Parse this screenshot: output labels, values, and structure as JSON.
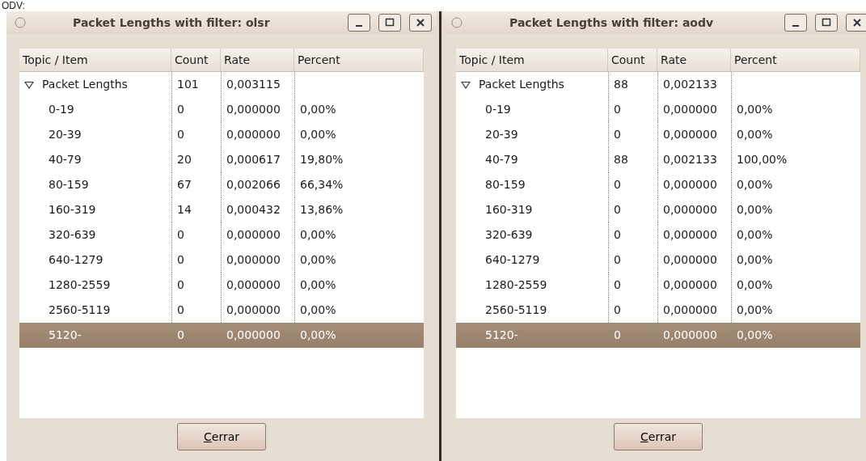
{
  "caption": "ODV:",
  "windows": [
    {
      "title": "Packet Lengths with filter: olsr",
      "columns": [
        "Topic / Item",
        "Count",
        "Rate",
        "Percent"
      ],
      "tree": {
        "label": "Packet Lengths",
        "count": "101",
        "rate": "0,003115",
        "expanded": true,
        "selected": false,
        "children": [
          {
            "label": "0-19",
            "count": "0",
            "rate": "0,000000",
            "percent": "0,00%",
            "selected": false
          },
          {
            "label": "20-39",
            "count": "0",
            "rate": "0,000000",
            "percent": "0,00%",
            "selected": false
          },
          {
            "label": "40-79",
            "count": "20",
            "rate": "0,000617",
            "percent": "19,80%",
            "selected": false
          },
          {
            "label": "80-159",
            "count": "67",
            "rate": "0,002066",
            "percent": "66,34%",
            "selected": false
          },
          {
            "label": "160-319",
            "count": "14",
            "rate": "0,000432",
            "percent": "13,86%",
            "selected": false
          },
          {
            "label": "320-639",
            "count": "0",
            "rate": "0,000000",
            "percent": "0,00%",
            "selected": false
          },
          {
            "label": "640-1279",
            "count": "0",
            "rate": "0,000000",
            "percent": "0,00%",
            "selected": false
          },
          {
            "label": "1280-2559",
            "count": "0",
            "rate": "0,000000",
            "percent": "0,00%",
            "selected": false
          },
          {
            "label": "2560-5119",
            "count": "0",
            "rate": "0,000000",
            "percent": "0,00%",
            "selected": false
          },
          {
            "label": "5120-",
            "count": "0",
            "rate": "0,000000",
            "percent": "0,00%",
            "selected": true
          }
        ]
      },
      "button": {
        "label": "Cerrar",
        "mnemonic": true
      }
    },
    {
      "title": "Packet Lengths with filter: aodv",
      "columns": [
        "Topic / Item",
        "Count",
        "Rate",
        "Percent"
      ],
      "tree": {
        "label": "Packet Lengths",
        "count": "88",
        "rate": "0,002133",
        "expanded": true,
        "selected": false,
        "children": [
          {
            "label": "0-19",
            "count": "0",
            "rate": "0,000000",
            "percent": "0,00%",
            "selected": false
          },
          {
            "label": "20-39",
            "count": "0",
            "rate": "0,000000",
            "percent": "0,00%",
            "selected": false
          },
          {
            "label": "40-79",
            "count": "88",
            "rate": "0,002133",
            "percent": "100,00%",
            "selected": false
          },
          {
            "label": "80-159",
            "count": "0",
            "rate": "0,000000",
            "percent": "0,00%",
            "selected": false
          },
          {
            "label": "160-319",
            "count": "0",
            "rate": "0,000000",
            "percent": "0,00%",
            "selected": false
          },
          {
            "label": "320-639",
            "count": "0",
            "rate": "0,000000",
            "percent": "0,00%",
            "selected": false
          },
          {
            "label": "640-1279",
            "count": "0",
            "rate": "0,000000",
            "percent": "0,00%",
            "selected": false
          },
          {
            "label": "1280-2559",
            "count": "0",
            "rate": "0,000000",
            "percent": "0,00%",
            "selected": false
          },
          {
            "label": "2560-5119",
            "count": "0",
            "rate": "0,000000",
            "percent": "0,00%",
            "selected": false
          },
          {
            "label": "5120-",
            "count": "0",
            "rate": "0,000000",
            "percent": "0,00%",
            "selected": true
          }
        ]
      },
      "button": {
        "label": "Cerrar",
        "mnemonic": true
      }
    }
  ]
}
